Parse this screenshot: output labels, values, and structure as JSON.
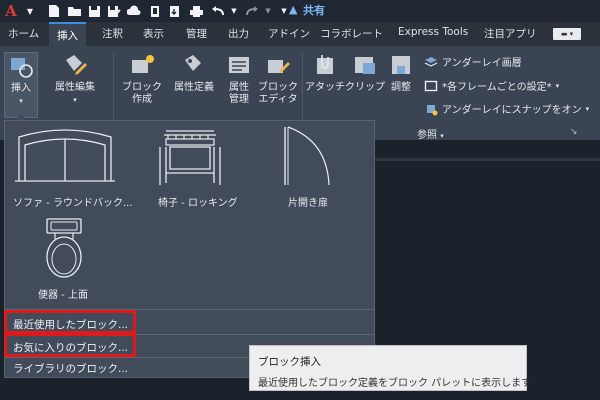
{
  "titlebar": {
    "share_label": "共有"
  },
  "tabs": [
    {
      "label": "ホーム"
    },
    {
      "label": "挿入"
    },
    {
      "label": "注釈"
    },
    {
      "label": "表示"
    },
    {
      "label": "管理"
    },
    {
      "label": "出力"
    },
    {
      "label": "アドイン"
    },
    {
      "label": "コラボレート"
    },
    {
      "label": "Express Tools"
    },
    {
      "label": "注目アプリ"
    }
  ],
  "ribbon": {
    "insert": "挿入",
    "edit_attribute": "属性編集",
    "create_block_1": "ブロック",
    "create_block_2": "作成",
    "define_attributes": "属性定義",
    "manage_attributes_1": "属性",
    "manage_attributes_2": "管理",
    "block_editor_1": "ブロック",
    "block_editor_2": "エディタ",
    "attach": "アタッチ",
    "clip": "クリップ",
    "adjust": "調整",
    "underlay_layers": "アンダーレイ画層",
    "frames_setting": "*各フレームごとの設定*",
    "snap_to_underlay": "アンダーレイにスナップをオン",
    "reference_panel": "参照"
  },
  "gallery": {
    "items": [
      {
        "label": "ソファ - ラウンドバック..."
      },
      {
        "label": "椅子 - ロッキング"
      },
      {
        "label": "片開き扉"
      },
      {
        "label": "便器 - 上面"
      }
    ],
    "menu": [
      {
        "label": "最近使用したブロック..."
      },
      {
        "label": "お気に入りのブロック..."
      },
      {
        "label": "ライブラリのブロック..."
      }
    ]
  },
  "tooltip": {
    "title": "ブロック挿入",
    "body": "最近使用したブロック定義をブロック パレットに表示します"
  },
  "colors": {
    "accent": "#3b8ee0",
    "highlight": "#e01a1a",
    "ribbon_bg": "#3b4453",
    "app_red": "#e0392f"
  }
}
